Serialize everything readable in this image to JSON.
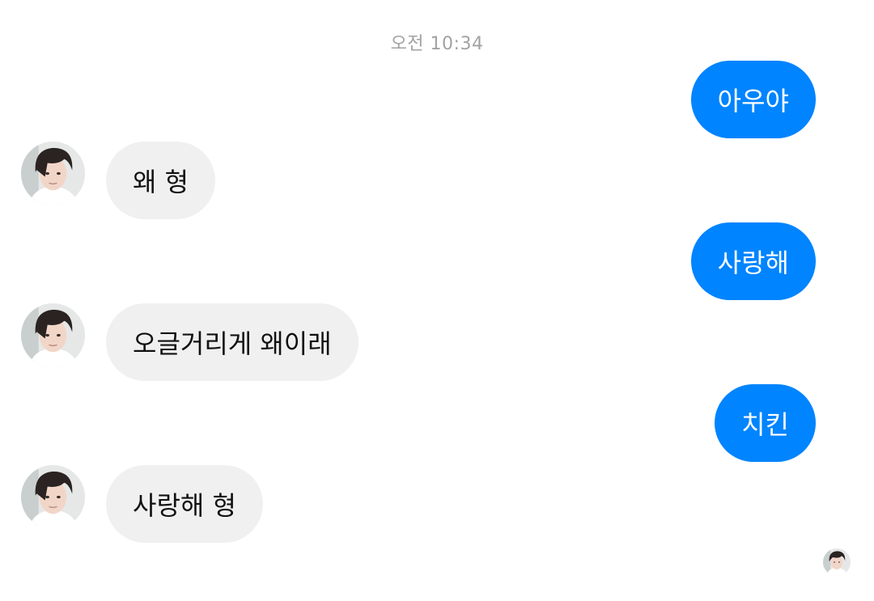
{
  "chat": {
    "timestamp": "오전 10:34",
    "messages": [
      {
        "direction": "outgoing",
        "text": "아우야"
      },
      {
        "direction": "incoming",
        "text": "왜 형"
      },
      {
        "direction": "outgoing",
        "text": "사랑해"
      },
      {
        "direction": "incoming",
        "text": "오글거리게 왜이래"
      },
      {
        "direction": "outgoing",
        "text": "치킨"
      },
      {
        "direction": "incoming",
        "text": "사랑해 형"
      }
    ]
  },
  "colors": {
    "outgoing_bubble": "#0084ff",
    "incoming_bubble": "#f0f0f0",
    "timestamp_text": "#a2a2a2"
  },
  "icons": {
    "avatar": "contact-avatar",
    "read_receipt": "seen-avatar-icon"
  }
}
